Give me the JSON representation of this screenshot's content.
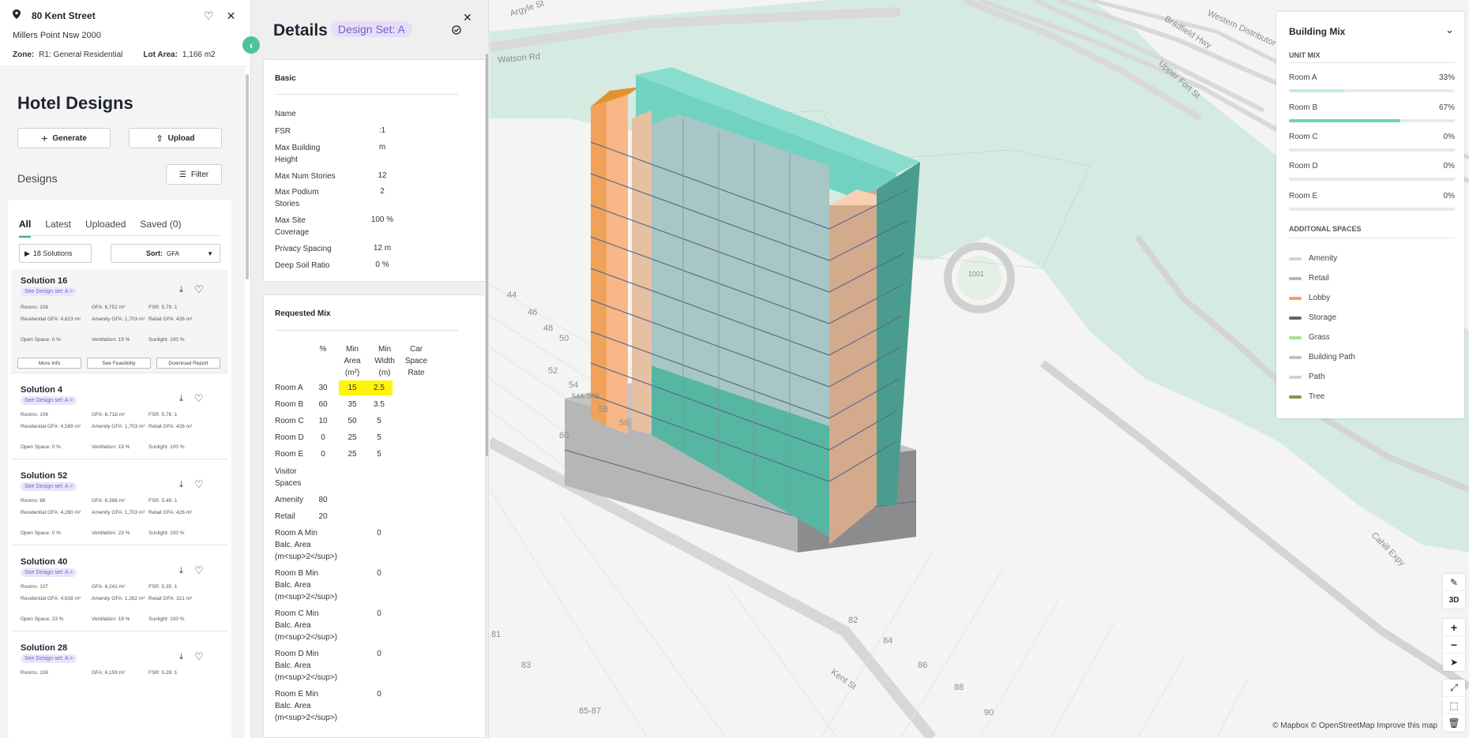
{
  "address": {
    "street": "80 Kent Street",
    "suburb": "Millers Point Nsw 2000",
    "zone_label": "Zone:",
    "zone_value": "R1: General Residential",
    "lot_area_label": "Lot Area:",
    "lot_area_value": "1,166 m2"
  },
  "left_panel": {
    "title": "Hotel Designs",
    "generate_label": "Generate",
    "upload_label": "Upload",
    "designs_label": "Designs",
    "filter_label": "Filter",
    "tabs": [
      "All",
      "Latest",
      "Uploaded",
      "Saved (0)"
    ],
    "solutions_count": "18 Solutions",
    "sort_label": "Sort:",
    "sort_value": "GFA",
    "solutions": [
      {
        "name": "Solution 16",
        "pill": "See Design set: A >",
        "rooms": "Rooms: 106",
        "gfa": "GFA: 6,752 m²",
        "fsr": "FSR: 5.79 :1",
        "res_gfa": "Residential GFA: 4,623 m²",
        "amenity_gfa": "Amenity GFA: 1,703 m²",
        "retail_gfa": "Retail GFA: 426 m²",
        "open_space": "Open Space: 0 %",
        "ventilation": "Ventilation: 19 %",
        "sunlight": "Sunlight: 100 %",
        "more_info": "More Info",
        "feasibility": "See Feasibility",
        "download": "Download Report"
      },
      {
        "name": "Solution 4",
        "pill": "See Design set: A >",
        "rooms": "Rooms: 106",
        "gfa": "GFA: 6,718 m²",
        "fsr": "FSR: 5.76 :1",
        "res_gfa": "Residential GFA: 4,589 m²",
        "amenity_gfa": "Amenity GFA: 1,703 m²",
        "retail_gfa": "Retail GFA: 426 m²",
        "open_space": "Open Space: 0 %",
        "ventilation": "Ventilation: 19 %",
        "sunlight": "Sunlight: 100 %"
      },
      {
        "name": "Solution 52",
        "pill": "See Design set: A >",
        "rooms": "Rooms: 88",
        "gfa": "GFA: 6,388 m²",
        "fsr": "FSR: 5.48 :1",
        "res_gfa": "Residential GFA: 4,260 m²",
        "amenity_gfa": "Amenity GFA: 1,703 m²",
        "retail_gfa": "Retail GFA: 426 m²",
        "open_space": "Open Space: 0 %",
        "ventilation": "Ventilation: 23 %",
        "sunlight": "Sunlight: 100 %"
      },
      {
        "name": "Solution 40",
        "pill": "See Design set: A >",
        "rooms": "Rooms: 107",
        "gfa": "GFA: 6,241 m²",
        "fsr": "FSR: 5.35 :1",
        "res_gfa": "Residential GFA: 4,638 m²",
        "amenity_gfa": "Amenity GFA: 1,282 m²",
        "retail_gfa": "Retail GFA: 321 m²",
        "open_space": "Open Space: 23 %",
        "ventilation": "Ventilation: 19 %",
        "sunlight": "Sunlight: 100 %"
      },
      {
        "name": "Solution 28",
        "pill": "See Design set: A >",
        "rooms": "Rooms: 106",
        "gfa": "GFA: 6,159 m²",
        "fsr": "FSR: 5.28 :1"
      }
    ]
  },
  "details": {
    "title": "Details",
    "design_set": "Design Set: A",
    "basic": {
      "header": "Basic",
      "rows": [
        {
          "label": "Name",
          "value": ""
        },
        {
          "label": "FSR",
          "value": ":1"
        },
        {
          "label": "Max Building Height",
          "value": "m"
        },
        {
          "label": "Max Num Stories",
          "value": "12"
        },
        {
          "label": "Max Podium Stories",
          "value": "2"
        },
        {
          "label": "Max Site Coverage",
          "value": "100 %"
        },
        {
          "label": "Privacy Spacing",
          "value": "12 m"
        },
        {
          "label": "Deep Soil Ratio",
          "value": "0 %"
        }
      ]
    },
    "requested_mix": {
      "header": "Requested Mix",
      "col_pct": "%",
      "col_min_area": "Min Area (m²)",
      "col_min_width": "Min Width (m)",
      "col_car": "Car Space Rate",
      "rooms": [
        {
          "label": "Room A",
          "pct": "30",
          "area": "15",
          "width": "2.5"
        },
        {
          "label": "Room B",
          "pct": "60",
          "area": "35",
          "width": "3.5"
        },
        {
          "label": "Room C",
          "pct": "10",
          "area": "50",
          "width": "5"
        },
        {
          "label": "Room D",
          "pct": "0",
          "area": "25",
          "width": "5"
        },
        {
          "label": "Room E",
          "pct": "0",
          "area": "25",
          "width": "5"
        }
      ],
      "visitor_spaces": "Visitor Spaces",
      "amenity": {
        "label": "Amenity",
        "pct": "80"
      },
      "retail": {
        "label": "Retail",
        "pct": "20"
      },
      "balconies": [
        {
          "label": "Room A Min Balc. Area (m<sup>2</sup>)",
          "value": "0"
        },
        {
          "label": "Room B Min Balc. Area (m<sup>2</sup>)",
          "value": "0"
        },
        {
          "label": "Room C Min Balc. Area (m<sup>2</sup>)",
          "value": "0"
        },
        {
          "label": "Room D Min Balc. Area (m<sup>2</sup>)",
          "value": "0"
        },
        {
          "label": "Room E Min Balc. Area (m<sup>2</sup>)",
          "value": "0"
        }
      ]
    }
  },
  "building_mix": {
    "title": "Building Mix",
    "unit_mix_label": "UNIT MIX",
    "units": [
      {
        "label": "Room A",
        "pct": "33%",
        "fraction": 0.33,
        "color": "#c4ece2"
      },
      {
        "label": "Room B",
        "pct": "67%",
        "fraction": 0.67,
        "color": "#6ed3b9"
      },
      {
        "label": "Room C",
        "pct": "0%",
        "fraction": 0,
        "color": "#6ed3b9"
      },
      {
        "label": "Room D",
        "pct": "0%",
        "fraction": 0,
        "color": "#6ed3b9"
      },
      {
        "label": "Room E",
        "pct": "0%",
        "fraction": 0,
        "color": "#6ed3b9"
      }
    ],
    "additional_label": "ADDITONAL SPACES",
    "spaces": [
      {
        "label": "Amenity",
        "color": "#e4cfc1"
      },
      {
        "label": "Retail",
        "color": "#b8b8b8"
      },
      {
        "label": "Lobby",
        "color": "#f4a061"
      },
      {
        "label": "Storage",
        "color": "#666666"
      },
      {
        "label": "Grass",
        "color": "#a6e38a"
      },
      {
        "label": "Building Path",
        "color": "#c2c2c2"
      },
      {
        "label": "Path",
        "color": "#d2d2d2"
      },
      {
        "label": "Tree",
        "color": "#7d9b47"
      }
    ]
  },
  "map": {
    "street_labels": [
      "Argyle St",
      "Watson Rd",
      "Bradfield Hwy",
      "Western Distributor",
      "Upper Fort St",
      "Kent St",
      "Cahill Expy"
    ],
    "lot_numbers": [
      "44",
      "46",
      "48",
      "50",
      "52",
      "54",
      "54A-54B",
      "56",
      "58",
      "60",
      "81",
      "82",
      "83",
      "84",
      "85-87",
      "86",
      "88",
      "90",
      "1001"
    ],
    "controls": [
      "pencil-icon",
      "3D",
      "+",
      "−",
      "compass-icon",
      "expand-icon",
      "select-icon",
      "trash-icon"
    ],
    "attribution": "© Mapbox © OpenStreetMap  Improve this map"
  }
}
